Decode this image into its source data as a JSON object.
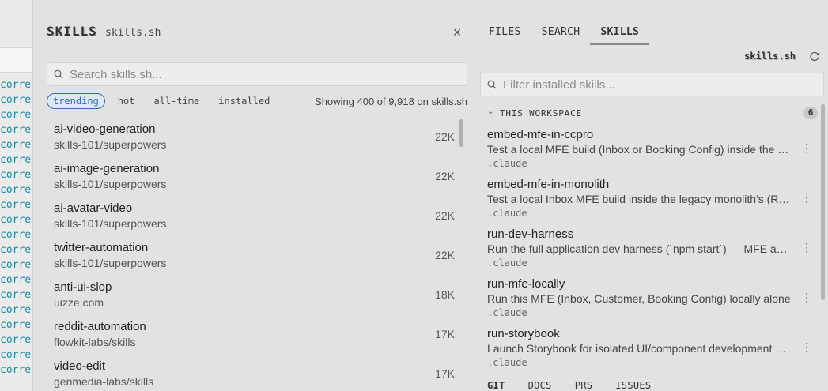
{
  "editor": {
    "code_lines": [
      "corre",
      "corre",
      "corre",
      "corre",
      "corre",
      "corre",
      "corre",
      "corre",
      "corre",
      "corre",
      "corre",
      "corre",
      "corre",
      "corre",
      "corre",
      "corre",
      "corre",
      "corre",
      "corre",
      "corre"
    ]
  },
  "skills_panel": {
    "title": "SKILLS",
    "subtitle": "skills.sh",
    "close_icon": "×",
    "search_placeholder": "Search skills.sh...",
    "filter_tabs": [
      {
        "label": "trending",
        "active": true
      },
      {
        "label": "hot",
        "active": false
      },
      {
        "label": "all-time",
        "active": false
      },
      {
        "label": "installed",
        "active": false
      }
    ],
    "showing_text": "Showing 400 of 9,918 on skills.sh",
    "skills": [
      {
        "name": "ai-video-generation",
        "repo": "skills-101/superpowers",
        "count": "22K"
      },
      {
        "name": "ai-image-generation",
        "repo": "skills-101/superpowers",
        "count": "22K"
      },
      {
        "name": "ai-avatar-video",
        "repo": "skills-101/superpowers",
        "count": "22K"
      },
      {
        "name": "twitter-automation",
        "repo": "skills-101/superpowers",
        "count": "22K"
      },
      {
        "name": "anti-ui-slop",
        "repo": "uizze.com",
        "count": "18K"
      },
      {
        "name": "reddit-automation",
        "repo": "flowkit-labs/skills",
        "count": "17K"
      },
      {
        "name": "video-edit",
        "repo": "genmedia-labs/skills",
        "count": "17K"
      }
    ]
  },
  "right_panel": {
    "tabs": [
      {
        "label": "FILES",
        "active": false
      },
      {
        "label": "SEARCH",
        "active": false
      },
      {
        "label": "SKILLS",
        "active": true
      }
    ],
    "source_label": "skills.sh",
    "filter_placeholder": "Filter installed skills...",
    "workspace": {
      "chevron": "⌄",
      "title": "THIS WORKSPACE",
      "count": "6"
    },
    "installed": [
      {
        "name": "embed-mfe-in-ccpro",
        "desc": "Test a local MFE build (Inbox or Booking Config) inside the CCPro portal",
        "path": ".claude"
      },
      {
        "name": "embed-mfe-in-monolith",
        "desc": "Test a local Inbox MFE build inside the legacy monolith's (Rails) shell",
        "path": ".claude"
      },
      {
        "name": "run-dev-harness",
        "desc": "Run the full application dev harness (`npm start`) — MFE and host together",
        "path": ".claude"
      },
      {
        "name": "run-mfe-locally",
        "desc": "Run this MFE (Inbox, Customer, Booking Config) locally alone",
        "path": ".claude"
      },
      {
        "name": "run-storybook",
        "desc": "Launch Storybook for isolated UI/component development and review",
        "path": ".claude"
      }
    ],
    "bottom_tabs": [
      {
        "label": "GIT",
        "active": true
      },
      {
        "label": "DOCS",
        "active": false
      },
      {
        "label": "PRS",
        "active": false
      },
      {
        "label": "ISSUES",
        "active": false
      }
    ]
  }
}
